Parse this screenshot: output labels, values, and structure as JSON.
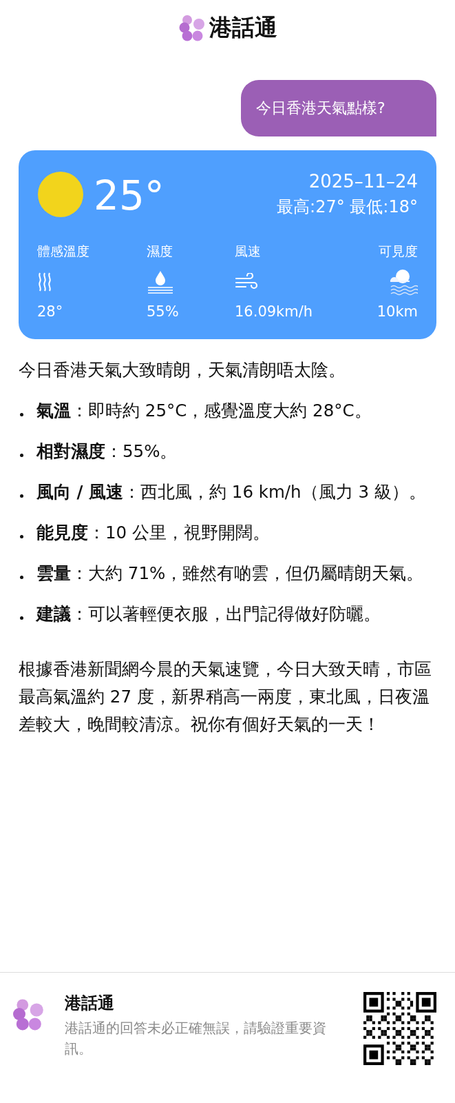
{
  "header": {
    "app_name": "港話通"
  },
  "user_message": "今日香港天氣點樣?",
  "weather": {
    "temperature": "25°",
    "date": "2025–11–24",
    "high_low": "最高:27° 最低:18°",
    "stats": [
      {
        "kind": "heat",
        "label": "體感溫度",
        "value": "28°"
      },
      {
        "kind": "humidity",
        "label": "濕度",
        "value": "55%"
      },
      {
        "kind": "wind",
        "label": "風速",
        "value": "16.09km/h"
      },
      {
        "kind": "visibility",
        "label": "可見度",
        "value": "10km"
      }
    ]
  },
  "reply": {
    "intro": "今日香港天氣大致晴朗，天氣清朗唔太陰。",
    "bullets": [
      "**氣溫**：即時約 25°C，感覺溫度大約 28°C。",
      "**相對濕度**：55%。",
      "**風向 / 風速**：西北風，約 16 km/h（風力 3 級）。",
      "**能見度**：10 公里，視野開闊。",
      "**雲量**：大約 71%，雖然有啲雲，但仍屬晴朗天氣。",
      "**建議**：可以著輕便衣服，出門記得做好防曬。"
    ],
    "summary": "根據香港新聞網今晨的天氣速覽，今日大致天晴，市區最高氣溫約 27 度，新界稍高一兩度，東北風，日夜溫差較大，晚間較清涼。祝你有個好天氣的一天！"
  },
  "footer": {
    "app_name": "港話通",
    "disclaimer": "港話通的回答未必正確無誤，請驗證重要資訊。"
  }
}
